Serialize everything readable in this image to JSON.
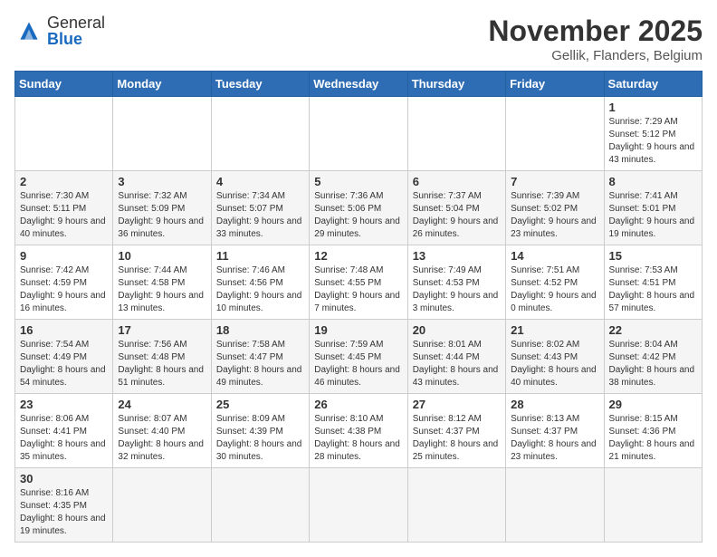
{
  "header": {
    "logo_general": "General",
    "logo_blue": "Blue",
    "month_title": "November 2025",
    "location": "Gellik, Flanders, Belgium"
  },
  "weekdays": [
    "Sunday",
    "Monday",
    "Tuesday",
    "Wednesday",
    "Thursday",
    "Friday",
    "Saturday"
  ],
  "weeks": [
    [
      {
        "day": "",
        "info": ""
      },
      {
        "day": "",
        "info": ""
      },
      {
        "day": "",
        "info": ""
      },
      {
        "day": "",
        "info": ""
      },
      {
        "day": "",
        "info": ""
      },
      {
        "day": "",
        "info": ""
      },
      {
        "day": "1",
        "info": "Sunrise: 7:29 AM\nSunset: 5:12 PM\nDaylight: 9 hours and 43 minutes."
      }
    ],
    [
      {
        "day": "2",
        "info": "Sunrise: 7:30 AM\nSunset: 5:11 PM\nDaylight: 9 hours and 40 minutes."
      },
      {
        "day": "3",
        "info": "Sunrise: 7:32 AM\nSunset: 5:09 PM\nDaylight: 9 hours and 36 minutes."
      },
      {
        "day": "4",
        "info": "Sunrise: 7:34 AM\nSunset: 5:07 PM\nDaylight: 9 hours and 33 minutes."
      },
      {
        "day": "5",
        "info": "Sunrise: 7:36 AM\nSunset: 5:06 PM\nDaylight: 9 hours and 29 minutes."
      },
      {
        "day": "6",
        "info": "Sunrise: 7:37 AM\nSunset: 5:04 PM\nDaylight: 9 hours and 26 minutes."
      },
      {
        "day": "7",
        "info": "Sunrise: 7:39 AM\nSunset: 5:02 PM\nDaylight: 9 hours and 23 minutes."
      },
      {
        "day": "8",
        "info": "Sunrise: 7:41 AM\nSunset: 5:01 PM\nDaylight: 9 hours and 19 minutes."
      }
    ],
    [
      {
        "day": "9",
        "info": "Sunrise: 7:42 AM\nSunset: 4:59 PM\nDaylight: 9 hours and 16 minutes."
      },
      {
        "day": "10",
        "info": "Sunrise: 7:44 AM\nSunset: 4:58 PM\nDaylight: 9 hours and 13 minutes."
      },
      {
        "day": "11",
        "info": "Sunrise: 7:46 AM\nSunset: 4:56 PM\nDaylight: 9 hours and 10 minutes."
      },
      {
        "day": "12",
        "info": "Sunrise: 7:48 AM\nSunset: 4:55 PM\nDaylight: 9 hours and 7 minutes."
      },
      {
        "day": "13",
        "info": "Sunrise: 7:49 AM\nSunset: 4:53 PM\nDaylight: 9 hours and 3 minutes."
      },
      {
        "day": "14",
        "info": "Sunrise: 7:51 AM\nSunset: 4:52 PM\nDaylight: 9 hours and 0 minutes."
      },
      {
        "day": "15",
        "info": "Sunrise: 7:53 AM\nSunset: 4:51 PM\nDaylight: 8 hours and 57 minutes."
      }
    ],
    [
      {
        "day": "16",
        "info": "Sunrise: 7:54 AM\nSunset: 4:49 PM\nDaylight: 8 hours and 54 minutes."
      },
      {
        "day": "17",
        "info": "Sunrise: 7:56 AM\nSunset: 4:48 PM\nDaylight: 8 hours and 51 minutes."
      },
      {
        "day": "18",
        "info": "Sunrise: 7:58 AM\nSunset: 4:47 PM\nDaylight: 8 hours and 49 minutes."
      },
      {
        "day": "19",
        "info": "Sunrise: 7:59 AM\nSunset: 4:45 PM\nDaylight: 8 hours and 46 minutes."
      },
      {
        "day": "20",
        "info": "Sunrise: 8:01 AM\nSunset: 4:44 PM\nDaylight: 8 hours and 43 minutes."
      },
      {
        "day": "21",
        "info": "Sunrise: 8:02 AM\nSunset: 4:43 PM\nDaylight: 8 hours and 40 minutes."
      },
      {
        "day": "22",
        "info": "Sunrise: 8:04 AM\nSunset: 4:42 PM\nDaylight: 8 hours and 38 minutes."
      }
    ],
    [
      {
        "day": "23",
        "info": "Sunrise: 8:06 AM\nSunset: 4:41 PM\nDaylight: 8 hours and 35 minutes."
      },
      {
        "day": "24",
        "info": "Sunrise: 8:07 AM\nSunset: 4:40 PM\nDaylight: 8 hours and 32 minutes."
      },
      {
        "day": "25",
        "info": "Sunrise: 8:09 AM\nSunset: 4:39 PM\nDaylight: 8 hours and 30 minutes."
      },
      {
        "day": "26",
        "info": "Sunrise: 8:10 AM\nSunset: 4:38 PM\nDaylight: 8 hours and 28 minutes."
      },
      {
        "day": "27",
        "info": "Sunrise: 8:12 AM\nSunset: 4:37 PM\nDaylight: 8 hours and 25 minutes."
      },
      {
        "day": "28",
        "info": "Sunrise: 8:13 AM\nSunset: 4:37 PM\nDaylight: 8 hours and 23 minutes."
      },
      {
        "day": "29",
        "info": "Sunrise: 8:15 AM\nSunset: 4:36 PM\nDaylight: 8 hours and 21 minutes."
      }
    ],
    [
      {
        "day": "30",
        "info": "Sunrise: 8:16 AM\nSunset: 4:35 PM\nDaylight: 8 hours and 19 minutes."
      },
      {
        "day": "",
        "info": ""
      },
      {
        "day": "",
        "info": ""
      },
      {
        "day": "",
        "info": ""
      },
      {
        "day": "",
        "info": ""
      },
      {
        "day": "",
        "info": ""
      },
      {
        "day": "",
        "info": ""
      }
    ]
  ]
}
